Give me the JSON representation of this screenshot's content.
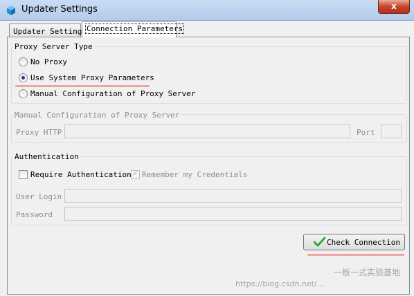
{
  "window": {
    "title": "Updater Settings",
    "close_label": "x"
  },
  "tabs": [
    {
      "label": "Updater Settings",
      "active": false
    },
    {
      "label": "Connection Parameters",
      "active": true
    }
  ],
  "proxy_type": {
    "title": "Proxy Server Type",
    "options": [
      {
        "label": "No Proxy",
        "checked": false
      },
      {
        "label": "Use System Proxy Parameters",
        "checked": true
      },
      {
        "label": "Manual Configuration of Proxy Server",
        "checked": false
      }
    ]
  },
  "manual_config": {
    "title": "Manual Configuration of Proxy Server",
    "http_label": "Proxy HTTP",
    "http_value": "",
    "port_label": "Port",
    "port_value": ""
  },
  "authentication": {
    "title": "Authentication",
    "require_label": "Require Authentication",
    "require_checked": false,
    "remember_label": "Remember my Credentials",
    "remember_checked": true,
    "login_label": "User Login",
    "login_value": "",
    "password_label": "Password",
    "password_value": ""
  },
  "actions": {
    "check_connection_label": "Check Connection"
  },
  "watermark": {
    "text": "一板一式实验基地",
    "url": "https://blog.csdn.net/..."
  },
  "colors": {
    "highlight_underline": "#f0a3a3",
    "check_icon": "#3aa63a"
  }
}
